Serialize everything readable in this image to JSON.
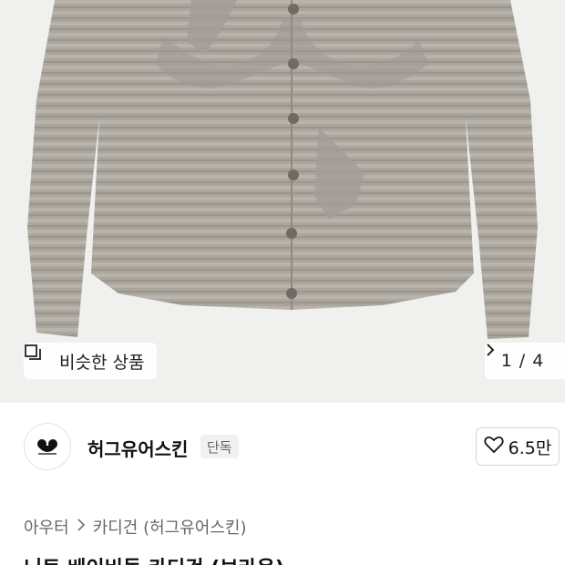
{
  "gallery": {
    "similar_label": "비슷한 상품",
    "current_page": "1",
    "separator": "/",
    "total_pages": "4",
    "background_color": "#f0f0ef",
    "garment_color": "#a8a49c"
  },
  "brand": {
    "name": "허그유어스킨",
    "badge": "단독",
    "like_count": "6.5만"
  },
  "breadcrumb": {
    "items": [
      "아우터",
      "카디건 (허그유어스킨)"
    ]
  },
  "product": {
    "title": "니트 베이비돌 카디건 (브라운)"
  }
}
